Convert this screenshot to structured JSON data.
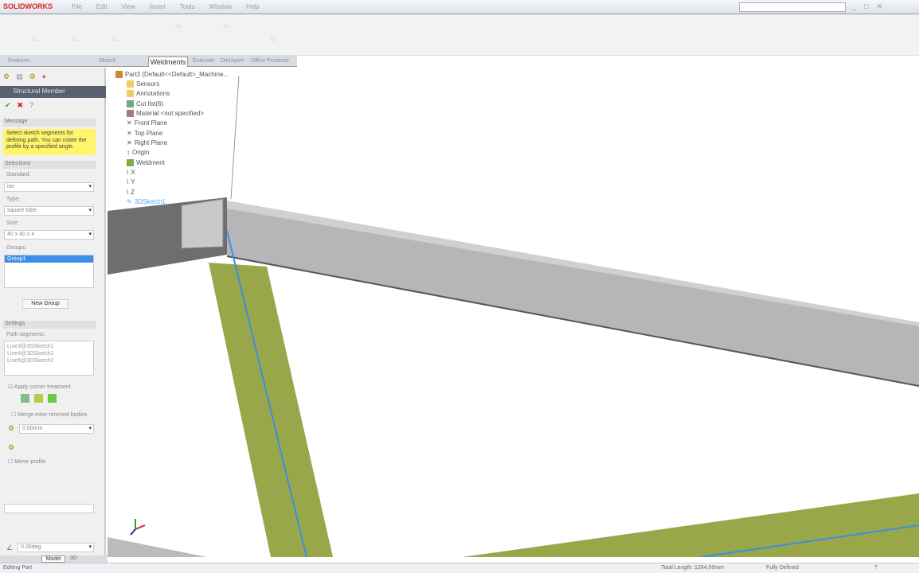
{
  "titlebar": {
    "brand": "SOLIDWORKS",
    "menus": [
      "File",
      "Edit",
      "View",
      "Insert",
      "Tools",
      "Window",
      "Help"
    ]
  },
  "ribbon": {
    "tabs_active": "Weldments",
    "tab_labels": [
      "Features",
      "Sketch",
      "Weldments",
      "Evaluate",
      "DimXpert",
      "Office Products"
    ]
  },
  "propertymanager": {
    "title": "Structural Member",
    "ok_label": "✔",
    "cancel_label": "✖",
    "help_label": "?",
    "message_group": "Message",
    "message": "Select sketch segments for defining path. You can rotate the profile by a specified angle.",
    "selections_group": "Selections",
    "standard_label": "Standard:",
    "standard_value": "iso",
    "type_label": "Type:",
    "type_value": "square tube",
    "size_label": "Size:",
    "size_value": "40 x 40 x 4",
    "groups_label": "Groups:",
    "group_item": "Group1",
    "new_group_button": "New Group",
    "settings_group": "Settings",
    "path_segments_label": "Path segments:",
    "path_segments": [
      "Line3@3DSketch1",
      "Line4@3DSketch1",
      "Line5@3DSketch1"
    ],
    "apply_corner_label": "Apply corner treatment",
    "merge_label": "Merge miter trimmed bodies",
    "gap_value": "0.00mm",
    "mirror_label": "Mirror profile",
    "rotation_value": "0.00deg"
  },
  "tree": {
    "root": "Part3 (Default<<Default>_Machine...",
    "items": [
      "Sensors",
      "Annotations",
      "Cut list(6)",
      "Material <not specified>",
      "Front Plane",
      "Top Plane",
      "Right Plane",
      "Origin",
      "Weldment",
      "X",
      "Y",
      "Z",
      "3DSketch1"
    ]
  },
  "bottom_tabs": {
    "model": "Model",
    "motion": "3D"
  },
  "status": {
    "left": "Editing Part",
    "length": "Total Length: 1264.00mm",
    "units": "Fully Defined",
    "help": "?"
  },
  "colors": {
    "beam": "#a8a8a8",
    "green_beam": "#9aa64a",
    "path_line": "#3a8ee6",
    "msg_bg": "#fff46a",
    "brand": "#d22"
  }
}
